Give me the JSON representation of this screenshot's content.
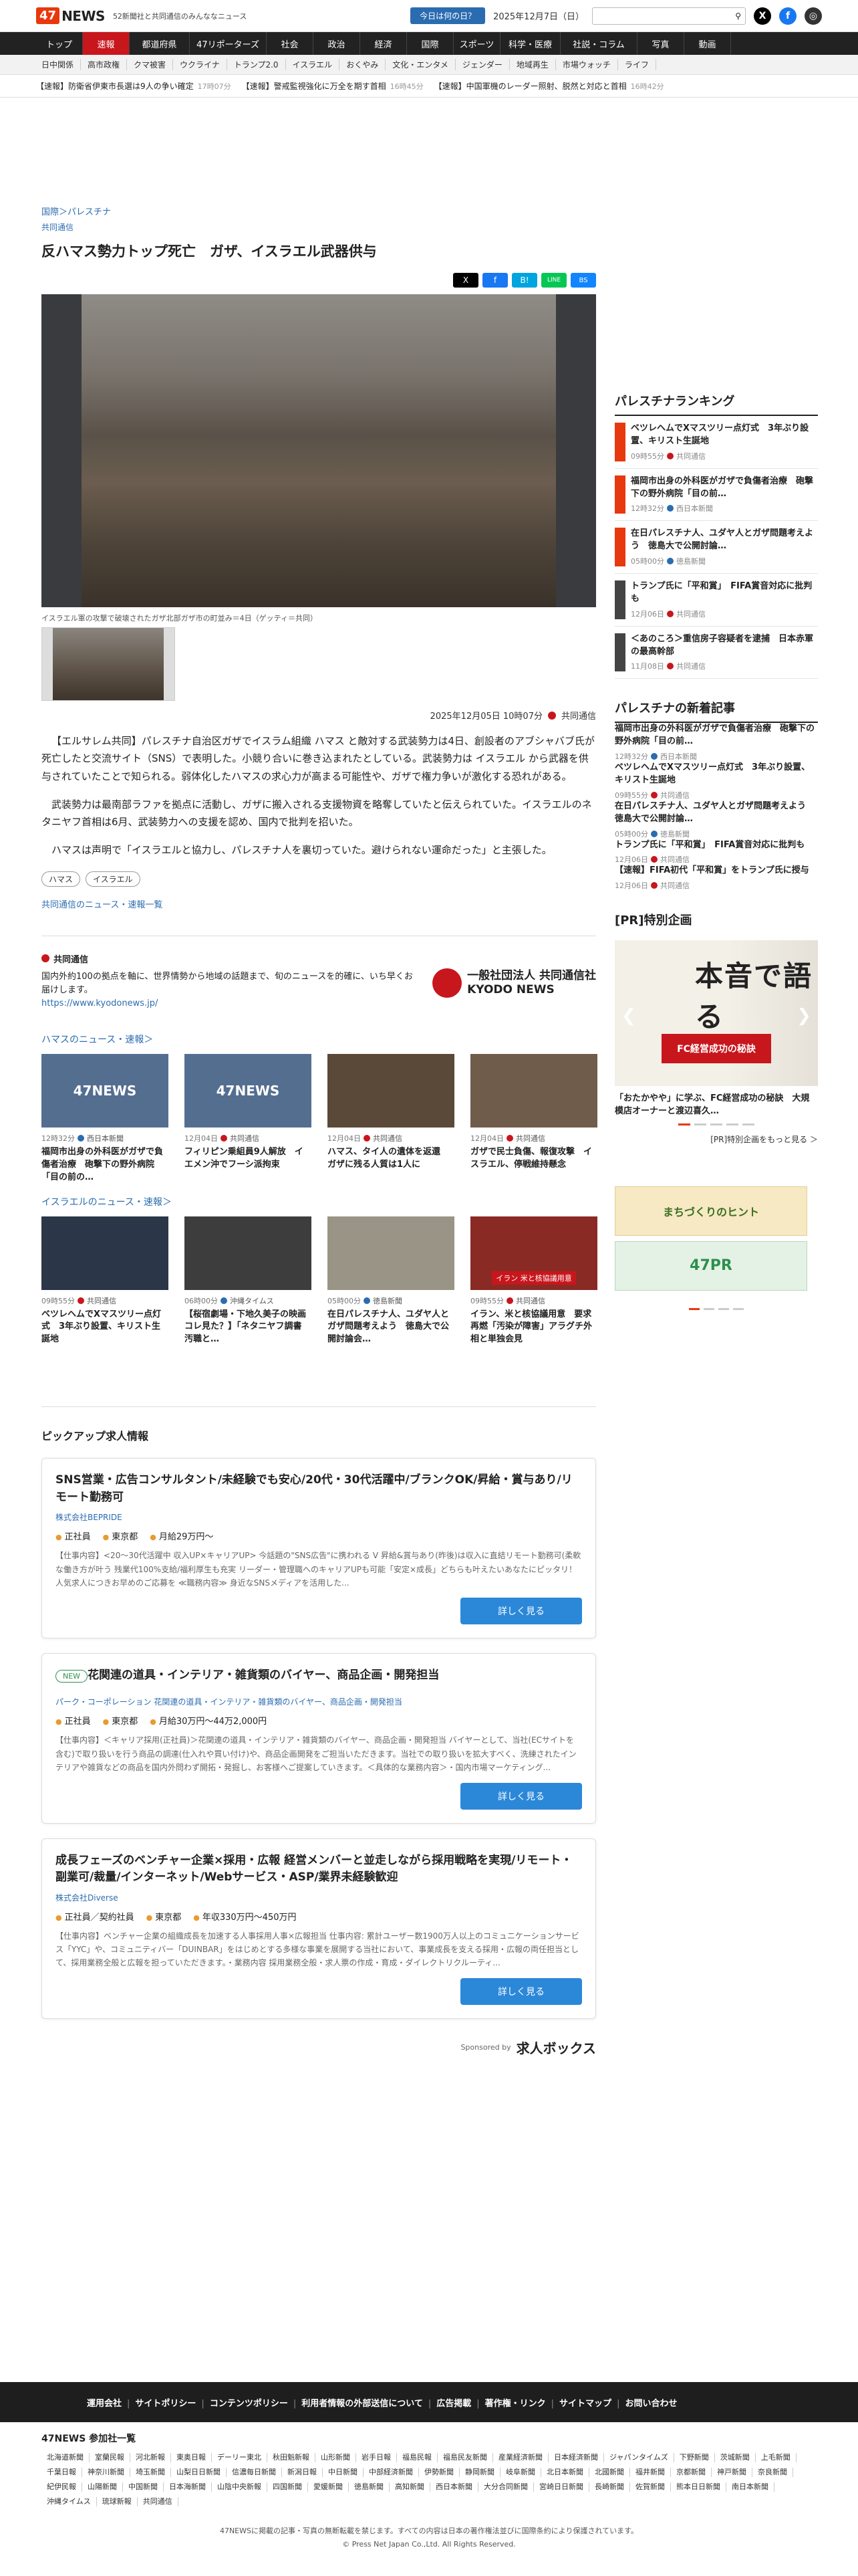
{
  "header": {
    "logo_number": "47",
    "logo_text": "NEWS",
    "tagline": "52新聞社と共同通信のみんななニュース",
    "today_button": "今日は何の日？",
    "date": "2025年12月7日（日）",
    "search_icon": "search-icon",
    "x_glyph": "X",
    "facebook_glyph": "f",
    "other_glyph": "◎"
  },
  "nav": [
    "トップ",
    "速報",
    "都道府県",
    "47リポーターズ",
    "社会",
    "政治",
    "経済",
    "国際",
    "スポーツ",
    "科学・医療",
    "社説・コラム",
    "写真",
    "動画"
  ],
  "nav_active": 1,
  "subnav": [
    "日中関係",
    "高市政権",
    "クマ被害",
    "ウクライナ",
    "トランプ2.0",
    "イスラエル",
    "おくやみ",
    "文化・エンタメ",
    "ジェンダー",
    "地域再生",
    "市場ウォッチ",
    "ライフ"
  ],
  "ticker": [
    {
      "text": "【速報】防衛省伊東市長選は9人の争い確定",
      "time": "17時07分"
    },
    {
      "text": "【速報】警戒監視強化に万全を期す首相",
      "time": "16時45分"
    },
    {
      "text": "【速報】中国軍機のレーダー照射、脱然と対応と首相",
      "time": "16時42分"
    }
  ],
  "article": {
    "breadcrumb": "国際＞パレスチナ",
    "source_label": "共同通信",
    "title": "反ハマス勢力トップ死亡　ガザ、イスラエル武器供与",
    "share": {
      "x": "X",
      "facebook": "f",
      "hatena": "B!",
      "line": "LINE",
      "bluesky": "BS"
    },
    "caption": "イスラエル軍の攻撃で破壊されたガザ北部ガザ市の町並み＝4日（ゲッティ＝共同）",
    "datetime": "2025年12月05日 10時07分",
    "source": "共同通信",
    "paragraphs": [
      "【エルサレム共同】パレスチナ自治区ガザでイスラム組織 ハマス と敵対する武装勢力は4日、創設者のアブシャバブ氏が死亡したと交流サイト（SNS）で表明した。小競り合いに巻き込まれたとしている。武装勢力は イスラエル から武器を供与されていたことで知られる。弱体化したハマスの求心力が高まる可能性や、ガザで権力争いが激化する恐れがある。",
      "武装勢力は最南部ラファを拠点に活動し、ガザに搬入される支援物資を略奪していたと伝えられていた。イスラエルのネタニヤフ首相は6月、武装勢力への支援を認め、国内で批判を招いた。",
      "ハマスは声明で「イスラエルと協力し、パレスチナ人を裏切っていた。避けられない運命だった」と主張した。"
    ],
    "tags": [
      "ハマス",
      "イスラエル"
    ],
    "more_link": "共同通信のニュース・速報一覧"
  },
  "kyodo_box": {
    "title": "共同通信",
    "description": "国内外約100の拠点を軸に、世界情勢から地域の話題まで、旬のニュースを的確に、いち早くお届けします。",
    "url": "https://www.kyodonews.jp/",
    "logo_text": "一般社団法人 共同通信社",
    "logo_sub": "KYODO NEWS"
  },
  "hamas_section": {
    "heading": "ハマスのニュース・速報＞",
    "items": [
      {
        "time": "12時32分",
        "source": "西日本新聞",
        "title": "福岡市出身の外科医がガザで負傷者治療　砲撃下の野外病院「目の前の…",
        "logo": "47NEWS"
      },
      {
        "time": "12月04日",
        "source": "共同通信",
        "title": "フィリピン乗組員9人解放　イエメン沖でフーシ派拘束",
        "logo": "47NEWS"
      },
      {
        "time": "12月04日",
        "source": "共同通信",
        "title": "ハマス、タイ人の遺体を返還　ガザに残る人質は1人に",
        "logo": ""
      },
      {
        "time": "12月04日",
        "source": "共同通信",
        "title": "ガザで民士負傷、報復攻撃　イスラエル、停戦維持懸念",
        "logo": ""
      }
    ]
  },
  "israel_section": {
    "heading": "イスラエルのニュース・速報＞",
    "items": [
      {
        "time": "09時55分",
        "source": "共同通信",
        "title": "ベツレヘムでXマスツリー点灯式　3年ぶり設置、キリスト生誕地"
      },
      {
        "time": "06時00分",
        "source": "沖縄タイムス",
        "title": "【桜宿劇場・下地久美子の映画コレ見た？】「ネタニヤフ調書　汚職と…"
      },
      {
        "time": "05時00分",
        "source": "徳島新聞",
        "title": "在日パレスチナ人、ユダヤ人とガザ問題考えよう　徳島大で公開討論会…"
      },
      {
        "time": "09時55分",
        "source": "共同通信",
        "title": "イラン、米と核協議用意　要求再燃「汚染が障害」アラグチ外相と単独会見",
        "badge": "イラン 米と核協議用意"
      }
    ]
  },
  "jobs": {
    "heading": "ピックアップ求人情報",
    "items": [
      {
        "new": "",
        "title": "SNS営業・広告コンサルタント/未経験でも安心/20代・30代活躍中/ブランクOK/昇給・賞与あり/リモート勤務可",
        "company": "株式会社BEPRIDE",
        "type": "正社員",
        "place": "東京都",
        "salary": "月給29万円〜",
        "desc": "【仕事内容】<20〜30代活躍中 収入UP×キャリアUP> 今話題の\"SNS広告\"に携われる V 昇給&賞与あり(昨後)は収入に直結リモート勤務可(柔軟な働き方が叶う 残業代100%支給/福利厚生も充実 リーダー・管理職へのキャリアUPも可能「安定×成長」どちらも叶えたいあなたにピッタリ！人気求人につきお早めのご応募を ≪職務内容≫ 身近なSNSメディアを活用した...",
        "button": "詳しく見る"
      },
      {
        "new": "NEW",
        "title": "花関連の道具・インテリア・雑貨類のバイヤー、商品企画・開発担当",
        "company": "パーク・コーポレーション 花関連の道具・インテリア・雑貨類のバイヤー、商品企画・開発担当",
        "type": "正社員",
        "place": "東京都",
        "salary": "月給30万円〜44万2,000円",
        "desc": "【仕事内容】＜キャリア採用(正社員)＞花関連の道具・インテリア・雑貨類のバイヤー、商品企画・開発担当 バイヤーとして、当社(ECサイトを含む)で取り扱いを行う商品の調達(仕入れや買い付け)や、商品企画開発をご担当いただきます。当社での取り扱いを拡大すべく、洗練されたインテリアや雑貨などの商品を国内外問わず開拓・発掘し、お客様へご提案していきます。＜具体的な業務内容＞・国内市場マーケティング...",
        "button": "詳しく見る"
      },
      {
        "new": "",
        "title": "成長フェーズのベンチャー企業×採用・広報 経営メンバーと並走しながら採用戦略を実現/リモート・副業可/裁量/インターネット/Webサービス・ASP/業界未経験歓迎",
        "company": "株式会社Diverse",
        "type": "正社員／契約社員",
        "place": "東京都",
        "salary": "年収330万円〜450万円",
        "desc": "【仕事内容】ベンチャー企業の組織成長を加速する人事採用人事×広報担当 仕事内容: 累計ユーザー数1900万人以上のコミュニケーションサービス「YYC」や、コミュニティバー「DUINBAR」をはじめとする多様な事業を展開する当社において、事業成長を支える採用・広報の両任担当として、採用業務全般と広報を担っていただきます。・業務内容 採用業務全般・求人票の作成・育成・ダイレクトリクルーティ...",
        "button": "詳しく見る"
      }
    ],
    "sponsored_label": "Sponsored by",
    "sponsor_name": "求人ボックス"
  },
  "sidebar": {
    "ranking_heading": "パレスチナランキング",
    "ranking": [
      {
        "title": "ベツレヘムでXマスツリー点灯式　3年ぶり設置、キリスト生誕地",
        "time": "09時55分",
        "source": "共同通信"
      },
      {
        "title": "福岡市出身の外科医がガザで負傷者治療　砲撃下の野外病院「目の前…",
        "time": "12時32分",
        "source": "西日本新聞"
      },
      {
        "title": "在日パレスチナ人、ユダヤ人とガザ問題考えよう　徳島大で公開討論…",
        "time": "05時00分",
        "source": "徳島新聞"
      },
      {
        "title": "トランプ氏に「平和賞」　FIFA賞音対応に批判も",
        "time": "12月06日",
        "source": "共同通信"
      },
      {
        "title": "＜あのころ＞重信房子容疑者を逮捕　日本赤軍の最高幹部",
        "time": "11月08日",
        "source": "共同通信"
      }
    ],
    "new_heading": "パレスチナの新着記事",
    "new_items": [
      {
        "title": "福岡市出身の外科医がガザで負傷者治療　砲撃下の野外病院「目の前…",
        "time": "12時32分",
        "source": "西日本新聞"
      },
      {
        "title": "ベツレヘムでXマスツリー点灯式　3年ぶり設置、キリスト生誕地",
        "time": "09時55分",
        "source": "共同通信"
      },
      {
        "title": "在日パレスチナ人、ユダヤ人とガザ問題考えよう　徳島大で公開討論…",
        "time": "05時00分",
        "source": "徳島新聞"
      },
      {
        "title": "トランプ氏に「平和賞」　FIFA賞音対応に批判も",
        "time": "12月06日",
        "source": "共同通信"
      },
      {
        "title": "【速報】FIFA初代「平和賞」をトランプ氏に授与",
        "time": "12月06日",
        "source": "共同通信"
      }
    ],
    "pr_heading": "[PR]特別企画",
    "pr_big": "本音で語る",
    "pr_band": "FC経営成功の秘訣",
    "pr_caption": "「おたかやや」に学ぶ、FC経営成功の秘訣　大規模店オーナーと渡辺喜久…",
    "pr_link": "[PR]特別企画をもっと見る ＞",
    "banner1": "まちづくりのヒント",
    "banner2": "47PR"
  },
  "footer": {
    "links": [
      "運用会社",
      "サイトポリシー",
      "コンテンツポリシー",
      "利用者情報の外部送信について",
      "広告掲載",
      "著作権・リンク",
      "サイトマップ",
      "お問い合わせ"
    ],
    "members_heading": "47NEWS 参加社一覧",
    "papers": [
      "北海道新聞",
      "室蘭民報",
      "河北新報",
      "東奥日報",
      "デーリー東北",
      "秋田魁新報",
      "山形新聞",
      "岩手日報",
      "福島民報",
      "福島民友新聞",
      "産業経済新聞",
      "日本経済新聞",
      "ジャパンタイムズ",
      "下野新聞",
      "茨城新聞",
      "上毛新聞",
      "千葉日報",
      "神奈川新聞",
      "埼玉新聞",
      "山梨日日新聞",
      "信濃毎日新聞",
      "新潟日報",
      "中日新聞",
      "中部経済新聞",
      "伊勢新聞",
      "静岡新聞",
      "岐阜新聞",
      "北日本新聞",
      "北國新聞",
      "福井新聞",
      "京都新聞",
      "神戸新聞",
      "奈良新聞",
      "紀伊民報",
      "山陽新聞",
      "中国新聞",
      "日本海新聞",
      "山陰中央新報",
      "四国新聞",
      "愛媛新聞",
      "徳島新聞",
      "高知新聞",
      "西日本新聞",
      "大分合同新聞",
      "宮崎日日新聞",
      "長崎新聞",
      "佐賀新聞",
      "熊本日日新聞",
      "南日本新聞",
      "沖縄タイムス",
      "琉球新報",
      "共同通信"
    ],
    "copyright1": "47NEWSに掲載の記事・写真の無断転載を禁じます。すべての内容は日本の著作権法並びに国際条約により保護されています。",
    "copyright2": "© Press Net Japan Co.,Ltd. All Rights Reserved."
  },
  "colors": {
    "brand": "#e8380d",
    "nav_active": "#c8161d",
    "link": "#2b6cb0",
    "button": "#2b88d9"
  }
}
